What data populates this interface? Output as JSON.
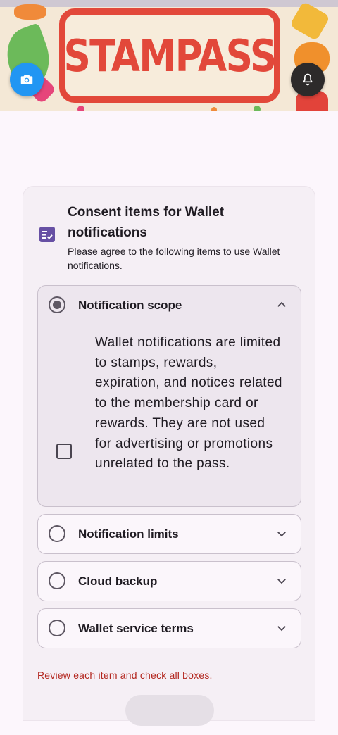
{
  "header": {
    "logo_text": "STAMPASS",
    "camera_icon": "camera-icon",
    "bell_icon": "bell-icon"
  },
  "consent": {
    "title": "Consent items for Wallet notifications",
    "subtitle": "Please agree to the following items to use Wallet notifications.",
    "items": [
      {
        "label": "Notification scope",
        "expanded": true,
        "selected": true,
        "description": "Wallet notifications are limited to stamps, rewards, expiration, and notices related to the membership card or rewards. They are not used for advertising or promotions unrelated to the pass.",
        "checked": false
      },
      {
        "label": "Notification limits",
        "expanded": false,
        "selected": false
      },
      {
        "label": "Cloud backup",
        "expanded": false,
        "selected": false
      },
      {
        "label": "Wallet service terms",
        "expanded": false,
        "selected": false
      }
    ],
    "warning": "Review each item and check all boxes."
  },
  "colors": {
    "accent": "#6750a4",
    "camera_fab": "#2196f3",
    "bell_fab": "#2d2a2a",
    "warning": "#b3261e",
    "stamp_red": "#e2483a"
  }
}
